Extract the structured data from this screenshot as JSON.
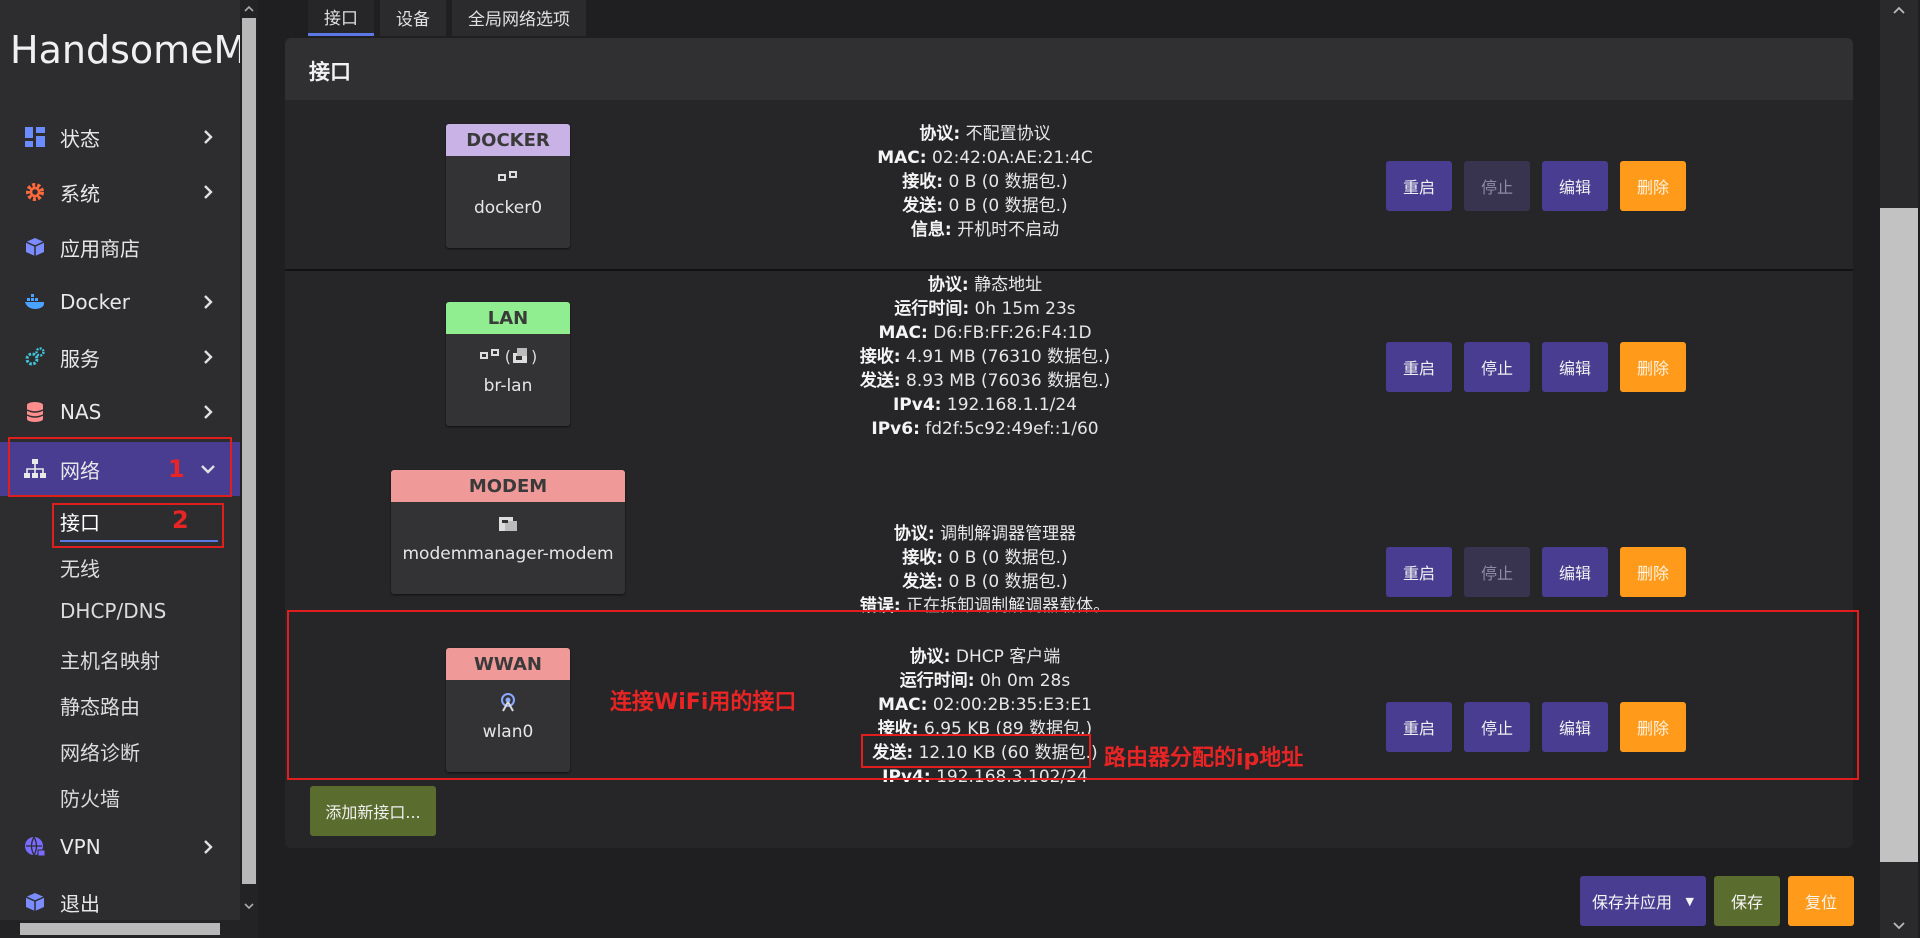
{
  "sidebar": {
    "brand": "HandsomeMo",
    "items": [
      {
        "label": "状态"
      },
      {
        "label": "系统"
      },
      {
        "label": "应用商店"
      },
      {
        "label": "Docker"
      },
      {
        "label": "服务"
      },
      {
        "label": "NAS"
      },
      {
        "label": "网络"
      },
      {
        "label": "VPN"
      },
      {
        "label": "退出"
      }
    ],
    "network_sub": [
      "接口",
      "无线",
      "DHCP/DNS",
      "主机名映射",
      "静态路由",
      "网络诊断",
      "防火墙"
    ]
  },
  "tabs": [
    "接口",
    "设备",
    "全局网络选项"
  ],
  "panel": {
    "title": "接口",
    "interfaces": [
      {
        "name": "DOCKER",
        "device": "docker0",
        "color": "#c9b3e6",
        "info": [
          [
            "协议:",
            "不配置协议"
          ],
          [
            "MAC:",
            "02:42:0A:AE:21:4C"
          ],
          [
            "接收:",
            "0 B (0 数据包.)"
          ],
          [
            "发送:",
            "0 B (0 数据包.)"
          ],
          [
            "信息:",
            "开机时不启动"
          ]
        ]
      },
      {
        "name": "LAN",
        "device": "br-lan",
        "color": "#90ee90",
        "icon_suffix": ")",
        "icon_prefix": "(",
        "info": [
          [
            "协议:",
            "静态地址"
          ],
          [
            "运行时间:",
            "0h 15m 23s"
          ],
          [
            "MAC:",
            "D6:FB:FF:26:F4:1D"
          ],
          [
            "接收:",
            "4.91 MB (76310 数据包.)"
          ],
          [
            "发送:",
            "8.93 MB (76036 数据包.)"
          ],
          [
            "IPv4:",
            "192.168.1.1/24"
          ],
          [
            "IPv6:",
            "fd2f:5c92:49ef::1/60"
          ]
        ]
      },
      {
        "name": "MODEM",
        "device": "modemmanager-modem",
        "color": "#f09999",
        "info": [
          [
            "协议:",
            "调制解调器管理器"
          ],
          [
            "接收:",
            "0 B (0 数据包.)"
          ],
          [
            "发送:",
            "0 B (0 数据包.)"
          ],
          [
            "错误:",
            "正在拆卸调制解调器载体。"
          ]
        ]
      },
      {
        "name": "WWAN",
        "device": "wlan0",
        "color": "#f09999",
        "info": [
          [
            "协议:",
            "DHCP 客户端"
          ],
          [
            "运行时间:",
            "0h 0m 28s"
          ],
          [
            "MAC:",
            "02:00:2B:35:E3:E1"
          ],
          [
            "接收:",
            "6.95 KB (89 数据包.)"
          ],
          [
            "发送:",
            "12.10 KB (60 数据包.)"
          ],
          [
            "IPv4:",
            "192.168.3.102/24"
          ]
        ]
      }
    ],
    "buttons": {
      "restart": "重启",
      "stop": "停止",
      "edit": "编辑",
      "delete": "删除"
    },
    "add_button": "添加新接口..."
  },
  "annotations": {
    "num1": "1",
    "num2": "2",
    "wifi_note": "连接WiFi用的接口",
    "ip_note": "路由器分配的ip地址"
  },
  "footer": {
    "save_apply": "保存并应用",
    "dropdown_arrow": "▼",
    "save": "保存",
    "reset": "复位"
  },
  "colors": {
    "accent_purple": "#493d92",
    "orange": "#ff9a1a",
    "green_btn": "#5a6d2e",
    "annotation_red": "#e01e1e"
  }
}
